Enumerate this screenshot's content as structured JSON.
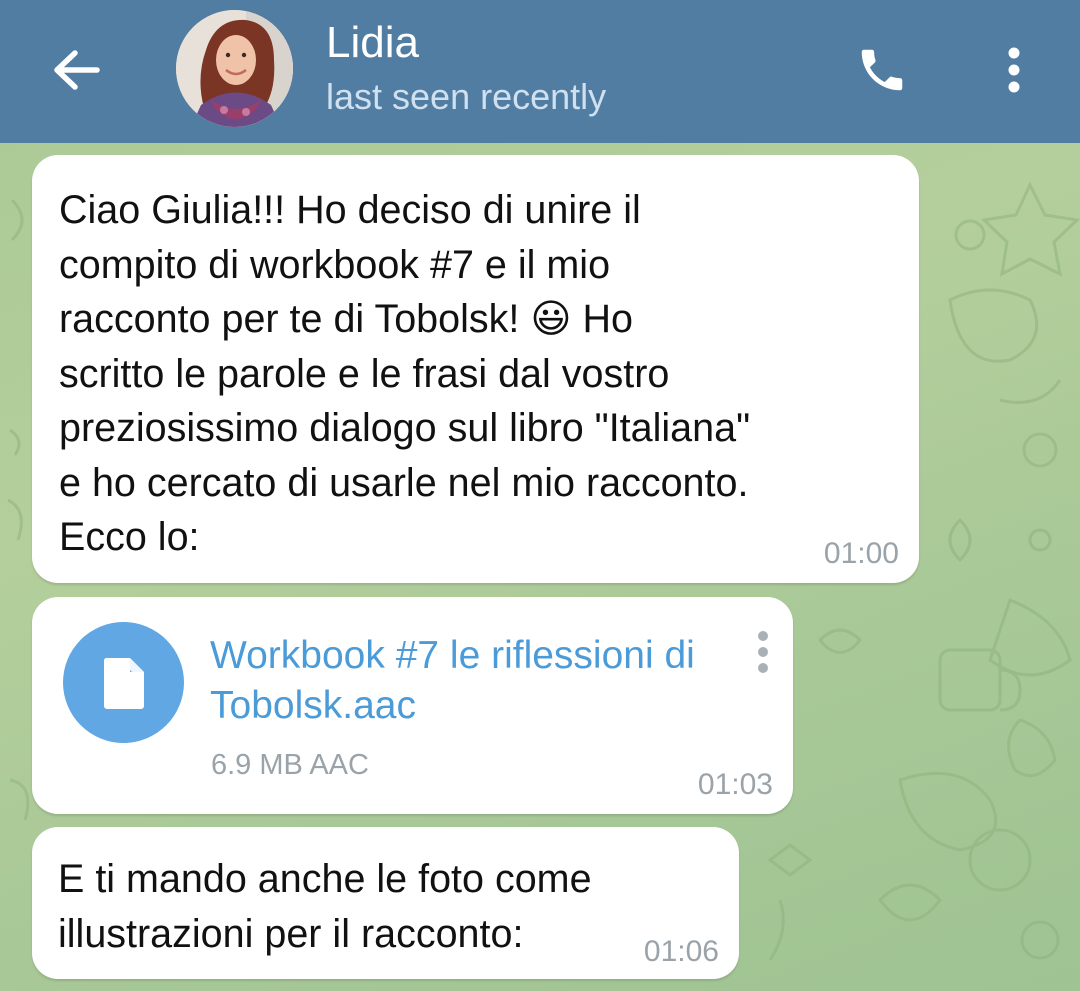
{
  "header": {
    "contact_name": "Lidia",
    "status": "last seen recently",
    "icons": {
      "back": "back-arrow-icon",
      "call": "phone-icon",
      "more": "more-vertical-icon"
    },
    "bar_color": "#517da2"
  },
  "messages": [
    {
      "type": "text",
      "text": "Ciao Giulia!!! Ho deciso di unire il\ncompito di workbook #7 e il mio\nracconto per te di Tobolsk! 😃 Ho\nscritto le parole e le frasi dal vostro\npreziosissimo dialogo sul libro \"Italiana\"\ne ho cercato di usarle nel mio racconto.\nEcco lo:",
      "time": "01:00"
    },
    {
      "type": "file",
      "file_name": "Workbook #7 le riflessioni di Tobolsk.aac",
      "file_meta": "6.9 MB AAC",
      "time": "01:03",
      "icon": "document-icon",
      "accent": "#61a7e3"
    },
    {
      "type": "text",
      "text": "E ti mando anche le foto come\nillustrazioni per il racconto:",
      "time": "01:06"
    }
  ]
}
